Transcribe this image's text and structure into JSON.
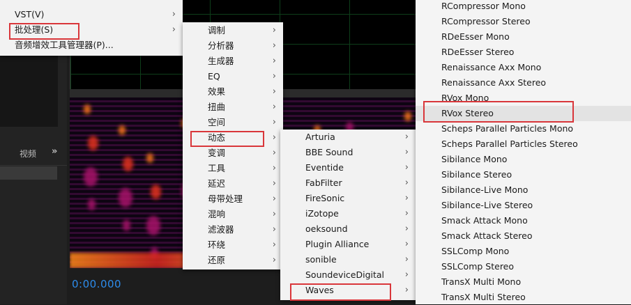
{
  "background": {
    "left_tab_label": "视频",
    "left_tab_prefix": "",
    "timecode": "0:00.000"
  },
  "menu1": {
    "items": [
      {
        "label": "VST(V)",
        "submenu": true
      },
      {
        "label": "批处理(S)",
        "submenu": true,
        "highlighted": true
      },
      {
        "label": "音频增效工具管理器(P)...",
        "submenu": false
      }
    ]
  },
  "menu2": {
    "items": [
      {
        "label": "调制",
        "submenu": true
      },
      {
        "label": "分析器",
        "submenu": true
      },
      {
        "label": "生成器",
        "submenu": true
      },
      {
        "label": "EQ",
        "submenu": true
      },
      {
        "label": "效果",
        "submenu": true
      },
      {
        "label": "扭曲",
        "submenu": true
      },
      {
        "label": "空间",
        "submenu": true
      },
      {
        "label": "动态",
        "submenu": true,
        "highlighted": true
      },
      {
        "label": "变调",
        "submenu": true
      },
      {
        "label": "工具",
        "submenu": true
      },
      {
        "label": "延迟",
        "submenu": true
      },
      {
        "label": "母带处理",
        "submenu": true
      },
      {
        "label": "混响",
        "submenu": true
      },
      {
        "label": "滤波器",
        "submenu": true
      },
      {
        "label": "环绕",
        "submenu": true
      },
      {
        "label": "还原",
        "submenu": true
      }
    ]
  },
  "menu3": {
    "items": [
      {
        "label": "Arturia",
        "submenu": true
      },
      {
        "label": "BBE Sound",
        "submenu": true
      },
      {
        "label": "Eventide",
        "submenu": true
      },
      {
        "label": "FabFilter",
        "submenu": true
      },
      {
        "label": "FireSonic",
        "submenu": true
      },
      {
        "label": "iZotope",
        "submenu": true
      },
      {
        "label": "oeksound",
        "submenu": true
      },
      {
        "label": "Plugin Alliance",
        "submenu": true
      },
      {
        "label": "sonible",
        "submenu": true
      },
      {
        "label": "SoundeviceDigital",
        "submenu": true
      },
      {
        "label": "Waves",
        "submenu": true,
        "highlighted": true
      }
    ]
  },
  "menu4": {
    "items": [
      {
        "label": "RCompressor Mono"
      },
      {
        "label": "RCompressor Stereo"
      },
      {
        "label": "RDeEsser Mono"
      },
      {
        "label": "RDeEsser Stereo"
      },
      {
        "label": "Renaissance Axx Mono"
      },
      {
        "label": "Renaissance Axx Stereo"
      },
      {
        "label": "RVox Mono"
      },
      {
        "label": "RVox Stereo",
        "highlighted": true
      },
      {
        "label": "Scheps Parallel Particles Mono"
      },
      {
        "label": "Scheps Parallel Particles Stereo"
      },
      {
        "label": "Sibilance Mono"
      },
      {
        "label": "Sibilance Stereo"
      },
      {
        "label": "Sibilance-Live Mono"
      },
      {
        "label": "Sibilance-Live Stereo"
      },
      {
        "label": "Smack Attack Mono"
      },
      {
        "label": "Smack Attack Stereo"
      },
      {
        "label": "SSLComp Mono"
      },
      {
        "label": "SSLComp Stereo"
      },
      {
        "label": "TransX Multi Mono"
      },
      {
        "label": "TransX Multi Stereo"
      }
    ]
  },
  "colors": {
    "highlight_border": "#d9363a",
    "timecode": "#2d8ceb",
    "menu_bg": "#f2f2f2"
  }
}
